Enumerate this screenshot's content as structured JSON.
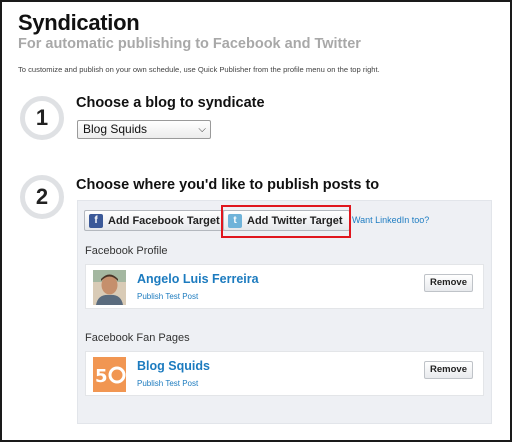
{
  "header": {
    "title": "Syndication",
    "subtitle": "For automatic publishing to Facebook and Twitter",
    "intro": "To customize and publish on your own schedule, use Quick Publisher from the profile menu on the top right."
  },
  "step1": {
    "number": "1",
    "title": "Choose a blog to syndicate",
    "selected_blog": "Blog Squids"
  },
  "step2": {
    "number": "2",
    "title": "Choose where you'd like to publish posts to",
    "add_facebook_label": "Add Facebook Target",
    "add_twitter_label": "Add Twitter Target",
    "linkedin_link": "Want LinkedIn too?",
    "facebook_profile_section": "Facebook Profile",
    "facebook_pages_section": "Facebook Fan Pages",
    "profile": {
      "name": "Angelo Luis Ferreira",
      "action": "Publish Test Post",
      "remove_label": "Remove"
    },
    "page": {
      "name": "Blog Squids",
      "action": "Publish Test Post",
      "remove_label": "Remove"
    }
  },
  "icons": {
    "facebook": "facebook-icon",
    "twitter": "twitter-icon",
    "dropdown": "chevron-down-icon"
  },
  "colors": {
    "link": "#1c7bbf",
    "highlight": "#e0161d",
    "facebook": "#3b5998",
    "twitter": "#6fb3d9",
    "subtitle": "#a8a8a8"
  }
}
